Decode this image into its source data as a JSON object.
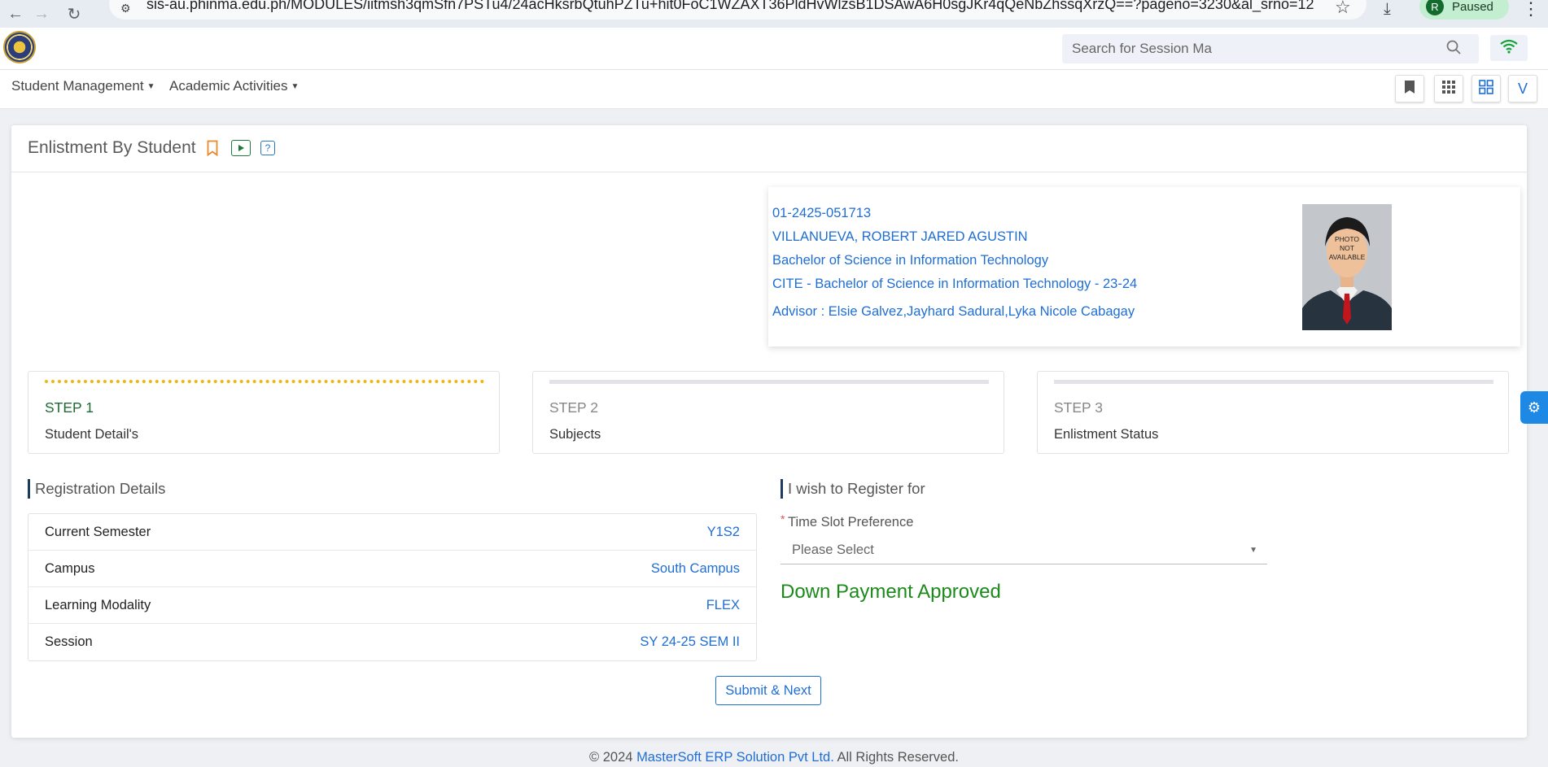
{
  "browser": {
    "url": "sis-au.phinma.edu.ph/MODULES/iitmsh3qmSfn7PSTu4/24acHksrbQtuhPZTu+hit0FoC1WZAXT36PldHvWlzsB1DSAwA6H0sgJKr4qQeNbZhssqXrzQ==?pageno=3230&al_srno=12",
    "profile_initial": "R",
    "profile_status": "Paused"
  },
  "header": {
    "search_placeholder": "Search for Session Ma"
  },
  "menu": {
    "items": [
      "Student Management",
      "Academic Activities"
    ],
    "toolbar_v": "V"
  },
  "page": {
    "title": "Enlistment By Student"
  },
  "student": {
    "id": "01-2425-051713",
    "name": "VILLANUEVA, ROBERT JARED AGUSTIN",
    "program": "Bachelor of Science in Information Technology",
    "curriculum": "CITE - Bachelor of Science in Information Technology - 23-24",
    "advisor": "Advisor : Elsie Galvez,Jayhard Sadural,Lyka Nicole Cabagay",
    "photo_text": [
      "PHOTO",
      "NOT",
      "AVAILABLE"
    ]
  },
  "steps": [
    {
      "label": "STEP 1",
      "sub": "Student Detail's"
    },
    {
      "label": "STEP 2",
      "sub": "Subjects"
    },
    {
      "label": "STEP 3",
      "sub": "Enlistment Status"
    }
  ],
  "registration": {
    "title": "Registration Details",
    "rows": [
      {
        "label": "Current Semester",
        "value": "Y1S2"
      },
      {
        "label": "Campus",
        "value": "South Campus"
      },
      {
        "label": "Learning Modality",
        "value": "FLEX"
      },
      {
        "label": "Session",
        "value": "SY 24-25 SEM II"
      }
    ]
  },
  "register_for": {
    "title": "I wish to Register for",
    "time_slot_label": "Time Slot Preference",
    "time_slot_value": "Please Select",
    "payment_status": "Down Payment Approved"
  },
  "actions": {
    "submit_label": "Submit & Next"
  },
  "footer": {
    "prefix": "© 2024",
    "brand": "MasterSoft ERP Solution Pvt Ltd.",
    "suffix": "All Rights Reserved."
  },
  "colors": {
    "link_blue": "#1f6ed4",
    "step_active_green": "#1d6b33",
    "step_dots_yellow": "#f2b705",
    "payment_green": "#1b8a1b"
  }
}
